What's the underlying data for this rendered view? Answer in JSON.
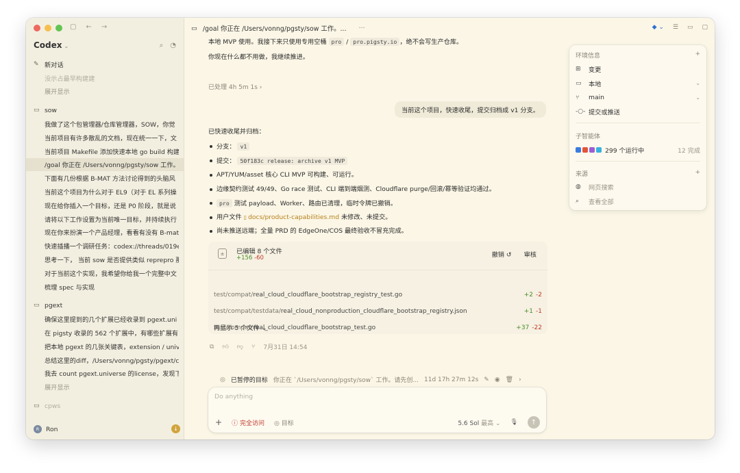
{
  "sidebar": {
    "brand": "Codex",
    "new_chat": "新对话",
    "top_items": [
      {
        "label": "没示占最早构建建"
      },
      {
        "label": "展开显示"
      }
    ],
    "projects": [
      {
        "name": "sow",
        "items": [
          "我做了这个包管理器/仓库管理器，SOW，你觉",
          "当前项目有许多散乱的文档，现在统一一下，文",
          "当前项目 Makefile 添加快速本地 go build 构建",
          "/goal 你正在 /Users/vonng/pgsty/sow 工作。请",
          "下面有几份根据 B-MAT 方法讨论得到的头脑风",
          "当前这个项目为什么对于 EL9（对于 EL 系列操",
          "现在给你插入一个目标，还是 P0 阶段，就是说",
          "请将以下工作设置为当前唯一目标，并持续执行",
          "现在你来扮演一个产品经理，看看有没有 B-mat",
          "快速插播一个调研任务：codex://threads/019e",
          "思考一下， 当前 sow 是否提供类似 reprepro 那",
          "对于当前这个实现，我希望你给我一个完整中文",
          "梳理 spec 与实现"
        ]
      },
      {
        "name": "pgext",
        "items": [
          "确保这里提到的几个扩展已经收录到 pgext.uni",
          "在 pigsty 收录的 562 个扩展中，有哪些扩展有",
          "把本地 pgext 的几张关键表，extension / unive",
          "总结这里的diff，/Users/vonng/pgsty/pgext/cli",
          "我去 count pgext.universe 的license，发现下",
          "展开显示"
        ]
      },
      {
        "name": "cpws",
        "items": []
      }
    ],
    "user_name": "Ron",
    "user_initial": "R"
  },
  "header": {
    "title": "/goal 你正在 /Users/vonng/pgsty/sow 工作。...",
    "more": "···"
  },
  "conversation": {
    "intro_line1_a": "本地 MVP 使用。我接下来只使用专用空桶",
    "code_pro": "pro",
    "slash": "/",
    "code_domain": "pro.pigsty.io",
    "intro_line1_b": "，绝不会写生产仓库。",
    "intro_line2": "你现在什么都不用做，我继续推进。",
    "processed": "已处理 4h 5m 1s",
    "user_message": "当前这个项目，快速收尾，提交归档成 v1 分支。",
    "summary_title": "已快速收尾并归档：",
    "b1_label": "分支：",
    "b1_code": "v1",
    "b2_label": "提交：",
    "b2_code": "50f183c release: archive v1 MVP",
    "b3": "APT/YUM/asset 核心 CLI MVP 可构建、可运行。",
    "b4": "边缘契约测试 49/49、Go race 测试、CLI 端到端烟测、Cloudflare purge/回滚/幂等验证均通过。",
    "b5_code": "pro",
    "b5_text": "测试 payload、Worker、路由已清理，临时令牌已撤销。",
    "b6_label": "用户文件",
    "b6_link": "docs/product-capabilities.md",
    "b6_tail": "未修改、未提交。",
    "b7": "尚未推送远端；全量 PRD 的 EdgeOne/COS 最终验收不冒充完成。"
  },
  "edits": {
    "title": "已编辑 8 个文件",
    "added": "+156",
    "removed": "-60",
    "undo": "撤销 ↺",
    "review": "审核",
    "files": [
      {
        "dir": "test/compat/",
        "name": "real_cloud_cloudflare_bootstrap_registry_test.go",
        "add": "+2",
        "del": "-2"
      },
      {
        "dir": "test/compat/testdata/",
        "name": "real_cloud_nonproduction_cloudflare_bootstrap_registry.json",
        "add": "+1",
        "del": "-1"
      },
      {
        "dir": "test/compat/",
        "name": "real_cloud_cloudflare_bootstrap_test.go",
        "add": "+37",
        "del": "-22"
      }
    ],
    "show_more": "再显示 5 个文件"
  },
  "message_meta": {
    "timestamp": "7月31日 14:54"
  },
  "paused_goal": {
    "label": "已暂停的目标",
    "text": "你正在 `/Users/vonng/pgsty/sow` 工作。请先创...",
    "elapsed": "11d 17h 27m 12s"
  },
  "composer": {
    "placeholder": "Do anything",
    "access": "完全访问",
    "goal": "目标",
    "model": "5.6 Sol",
    "model_level": "最高"
  },
  "panel": {
    "env_title": "环境信息",
    "env_items": [
      {
        "icon": "changes-icon",
        "label": "变更"
      },
      {
        "icon": "laptop-icon",
        "label": "本地"
      },
      {
        "icon": "branch-icon",
        "label": "main"
      },
      {
        "icon": "commit-icon",
        "label": "提交或推送"
      }
    ],
    "agents_title": "子智能体",
    "agents_running": "299 个运行中",
    "agents_done": "12 完成",
    "sources_title": "来源",
    "web_search": "网页搜索",
    "view_all": "查看全部"
  },
  "colors": {
    "accent_blue": "#2f6fd6",
    "danger": "#c0392b",
    "add_green": "#4a8a2a",
    "link_gold": "#b7811d"
  }
}
